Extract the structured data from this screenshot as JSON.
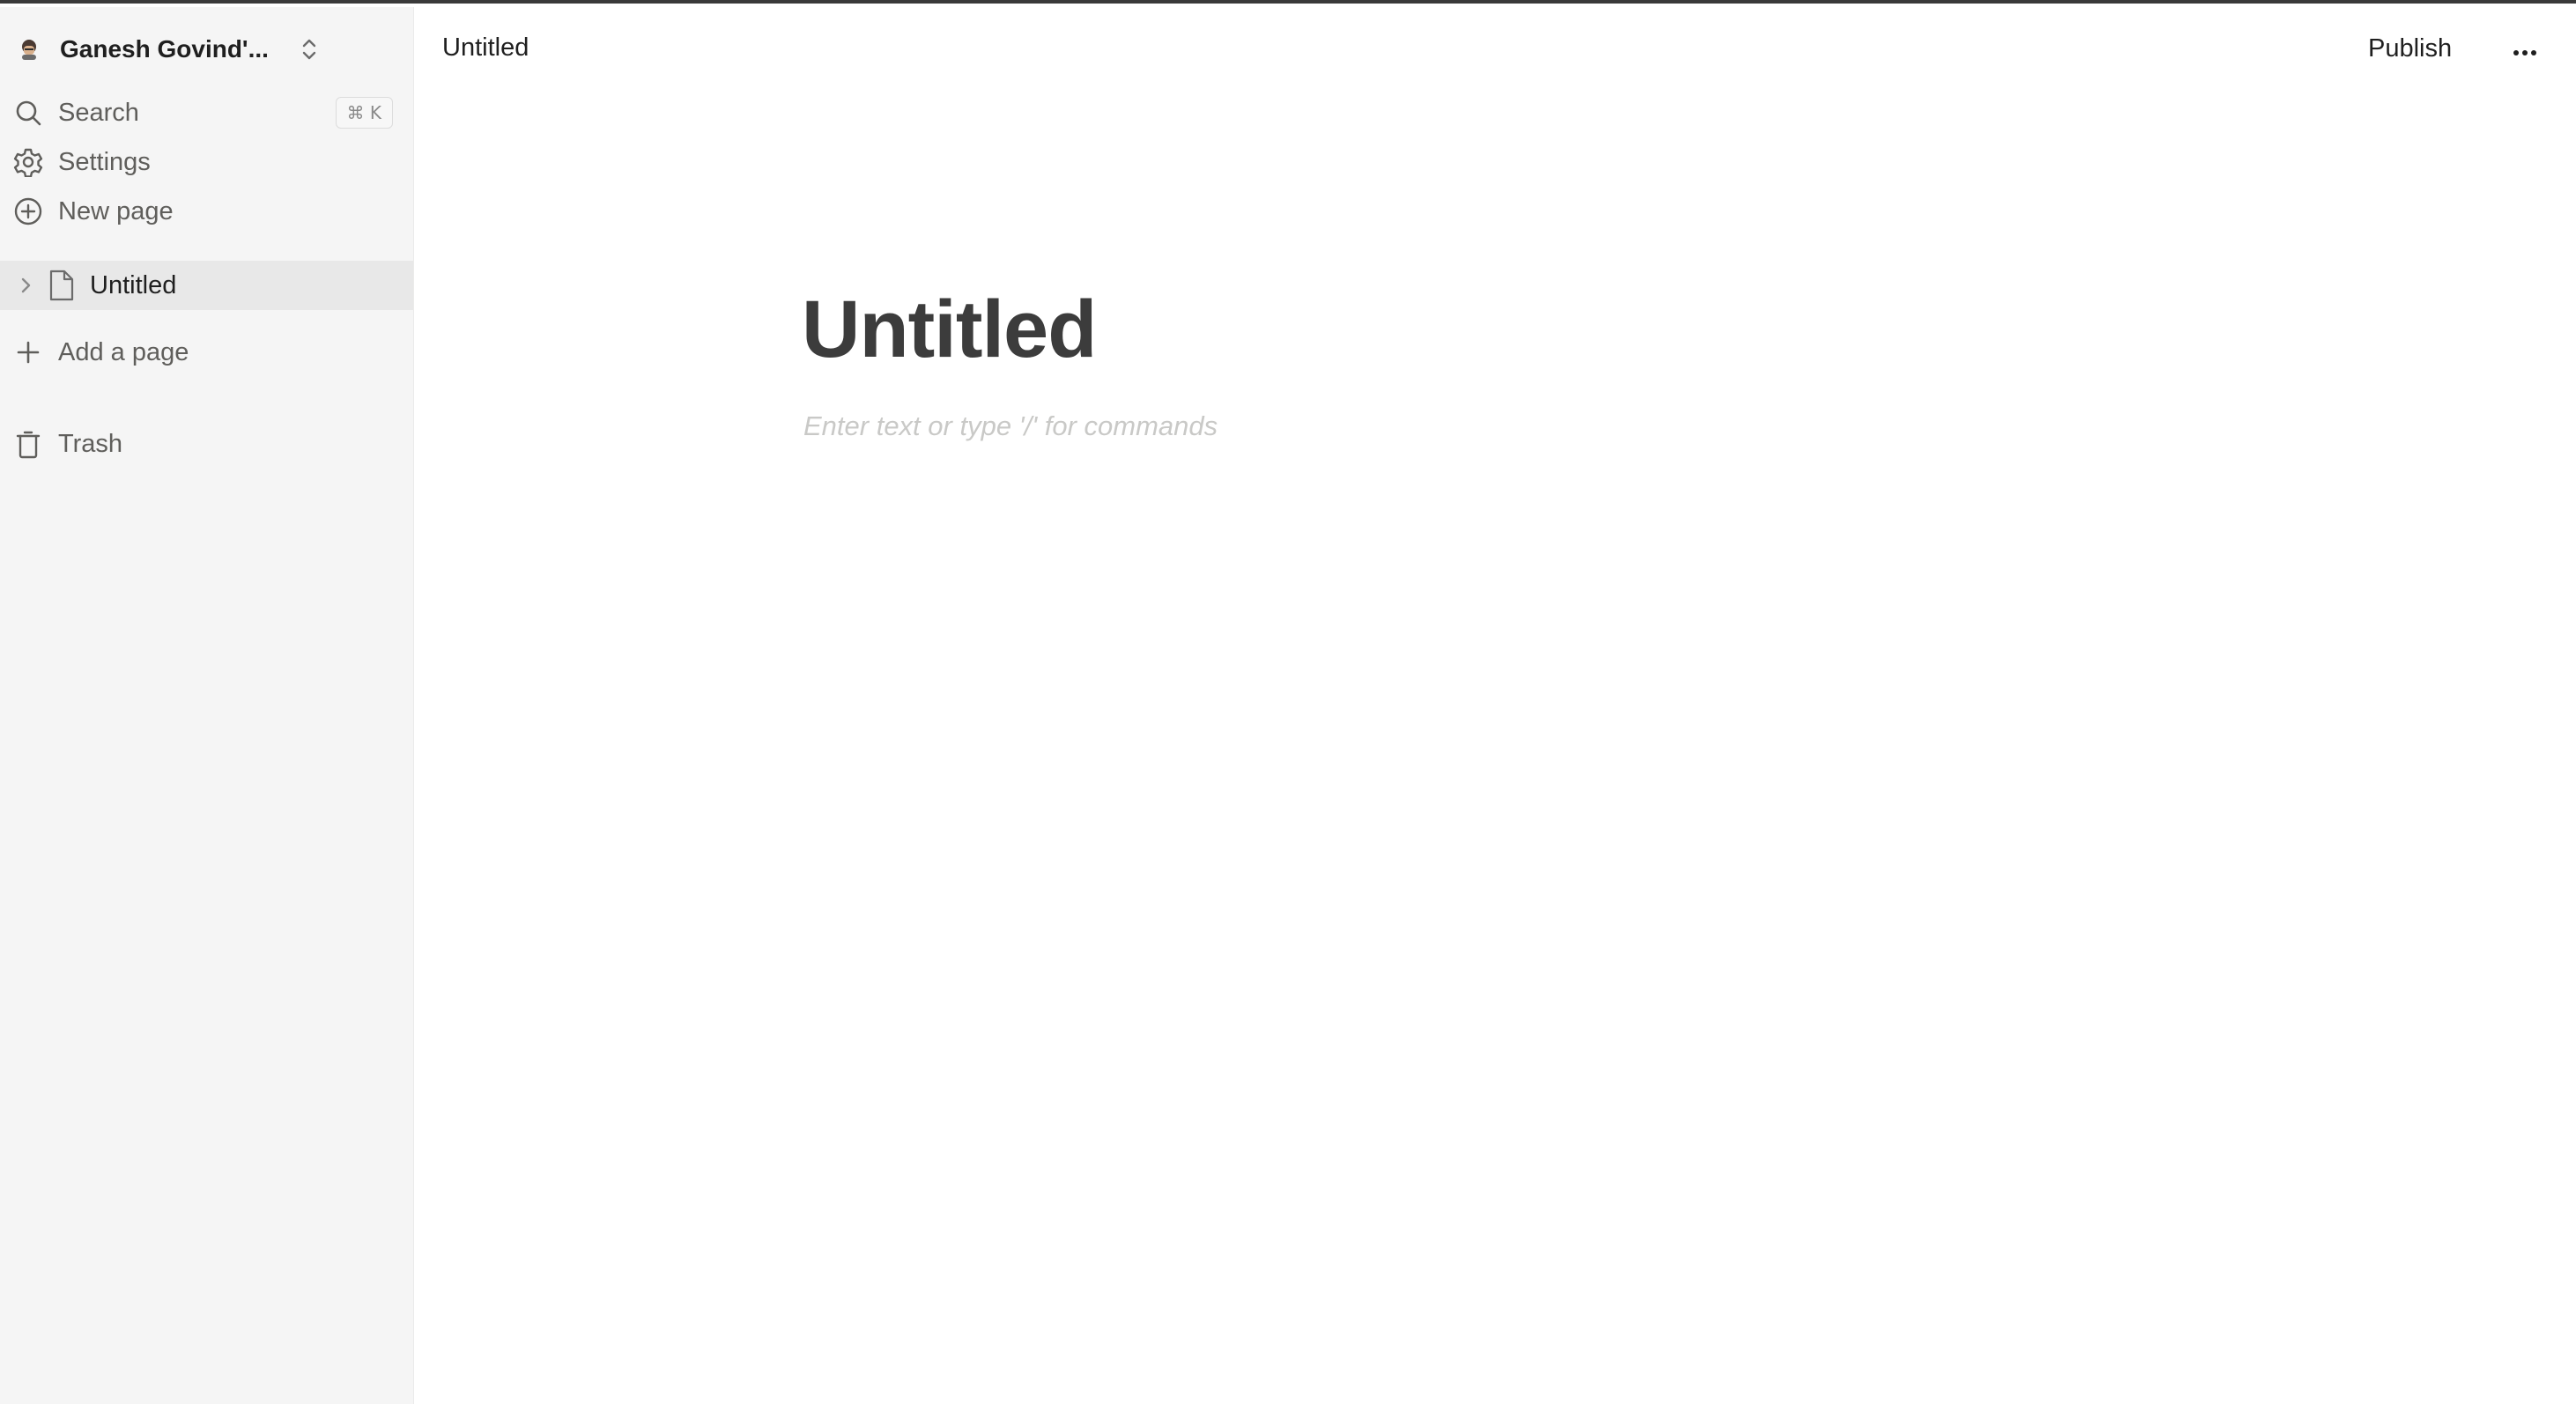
{
  "sidebar": {
    "workspace_name": "Ganesh Govind'...",
    "nav": {
      "search": "Search",
      "search_shortcut": "⌘ K",
      "settings": "Settings",
      "new_page": "New page",
      "add_page": "Add a page",
      "trash": "Trash"
    },
    "pages": [
      {
        "label": "Untitled",
        "selected": true
      }
    ]
  },
  "header": {
    "breadcrumb_title": "Untitled",
    "publish_label": "Publish"
  },
  "editor": {
    "title": "Untitled",
    "placeholder": "Enter text or type '/' for commands"
  },
  "icons": {
    "avatar": "avatar-icon",
    "switcher": "chevron-up-down-icon",
    "search": "search-icon",
    "settings": "gear-icon",
    "new_page": "plus-circle-icon",
    "expand": "chevron-right-icon",
    "page": "document-icon",
    "add": "plus-icon",
    "trash": "trash-icon",
    "more": "more-horizontal-icon"
  }
}
